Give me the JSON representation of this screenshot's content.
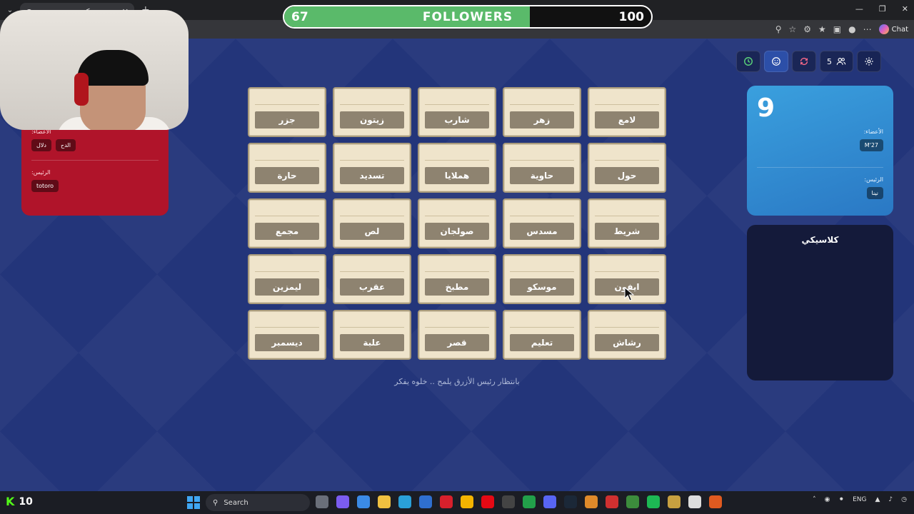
{
  "browser": {
    "tab_title": "كودنيمز",
    "chat_label": "Chat"
  },
  "overlay": {
    "followers_current": "67",
    "followers_label": "FOLLOWERS",
    "followers_goal": "100",
    "followers_progress": 0.67
  },
  "red_team": {
    "members_label": ":الأعضاء",
    "members": [
      "الدح",
      "دلال"
    ],
    "leader_label": ":الرئيس",
    "leader": "totoro"
  },
  "blue_team": {
    "score": "9",
    "members_label": ":الأعضاء",
    "members": [
      "M'27"
    ],
    "leader_label": ":الرئيس",
    "leader": "نينا"
  },
  "log_panel": {
    "title": "كلاسيكي"
  },
  "toolbar": {
    "players_count": "5"
  },
  "grid": {
    "cards": [
      "جزر",
      "زيتون",
      "شارب",
      "زهر",
      "لامع",
      "حارة",
      "تسديد",
      "هملايا",
      "حاوية",
      "حول",
      "مجمع",
      "لص",
      "صولجان",
      "مسدس",
      "شريط",
      "ليمزين",
      "عقرب",
      "مطبخ",
      "موسكو",
      "ايفون",
      "ديسمبر",
      "علبة",
      "قصر",
      "تعليم",
      "رشاش"
    ]
  },
  "status_text": "بانتظار رئيس الأزرق يلمح .. خلوه يفكر",
  "taskbar": {
    "kick_viewers": "10",
    "search_label": "Search",
    "lang": "ENG"
  },
  "colors": {
    "background": "#23357a",
    "red_team": "#b0142a",
    "blue_team": "#3aa0de",
    "card": "#efe4cb",
    "card_label": "#8e8370",
    "followers_fill": "#5aba6a"
  }
}
